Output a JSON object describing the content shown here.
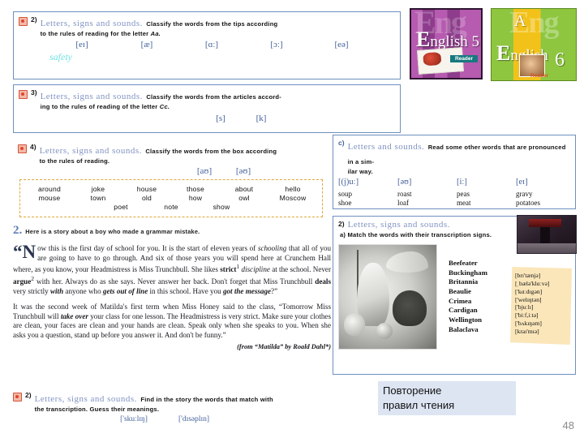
{
  "slide": {
    "page_number": "48",
    "caption": "Повторение\nправил чтения",
    "caption_line1": "Повторение",
    "caption_line2": "правил чтения",
    "caption_bg": "#dde5f3",
    "accent_title_color": "#8193c2",
    "transcription_color": "#44619b",
    "answer_color": "#6fe3e0"
  },
  "ex2": {
    "number": "2)",
    "title": "Letters, signs and sounds.",
    "instruction_line1": "Classify the words from the tips according",
    "instruction_line2": "to the rules of reading for the letter ",
    "instruction_letter": "Aa.",
    "transcriptions": [
      "[eɪ]",
      "[æ]",
      "[ɑː]",
      "[ɔː]",
      "[eə]"
    ],
    "answer": "safety"
  },
  "ex3": {
    "number": "3)",
    "title": "Letters, signs and sounds.",
    "instruction_line1": "Classify the words from the articles accord-",
    "instruction_line2": "ing to the rules of reading of the letter ",
    "instruction_letter": "Cc.",
    "transcriptions": [
      "[s]",
      "[k]"
    ]
  },
  "ex4": {
    "number": "4)",
    "title": "Letters, signs and sounds.",
    "instruction_line1": "Classify the words from the box according",
    "instruction_line2": "to the rules of reading.",
    "transcriptions": [
      "[aʊ]",
      "[əʊ]"
    ],
    "wordbox": {
      "row1": [
        "around",
        "joke",
        "house",
        "those",
        "about",
        "hello"
      ],
      "row2": [
        "mouse",
        "town",
        "old",
        "how",
        "owl",
        "Moscow"
      ],
      "row3": [
        "poet",
        "note",
        "show"
      ]
    }
  },
  "story": {
    "number": "2.",
    "subtitle": "Here is a story about a boy who made a grammar mistake.",
    "dropcap": "N",
    "opening_quote": "“",
    "paragraph1": "ow this is the first day of school for you. It is the start of eleven years of <i>schooling</i> that all of you are going to have to go through. And six of those years you will spend here at Crunchem Hall where, as you know, your Headmistress is Miss Trunchbull. She likes <b>strict</b><sup>1</sup> <i>discipline</i> at the school. Never <b>argue</b><sup>2</sup> with her. Always do as she says. Never answer her back. Don't forget that Miss Trunchbull <b>deals</b> very strictly <b><i>with</i></b> anyone who <b><i>gets out of line</i></b> in this school. Have you <b><i>got the message</i></b>?”",
    "paragraph2": "It was the second week of Matilda's first term when Miss Honey said to the class, “Tomorrow Miss Trunchbull will <b><i>take over</i></b> your class for one lesson. The Headmistress is very strict. Make sure your clothes are clean, your faces are clean and your hands are clean. Speak only when she speaks to you. When she asks you a question, stand up before you answer it. And don't be funny.”",
    "source": "(from “Matilda” by Roald Dahl*)"
  },
  "ex2b": {
    "number": "2)",
    "title": "Letters, signs and sounds.",
    "instruction_line1": "Find in the story the words that match with",
    "instruction_line2": "the transcription. Guess their meanings.",
    "transcriptions": [
      "['skuːlɪŋ]",
      "['dɪsəplɪn]"
    ]
  },
  "exC": {
    "number": "c)",
    "title": "Letters and sounds.",
    "instruction_line1": "Read some other words that are pronounced in a sim-",
    "instruction_line2": "ilar way.",
    "columns": [
      {
        "symbol": "[(j)uː]",
        "words": [
          "soup",
          "shoe"
        ]
      },
      {
        "symbol": "[əʊ]",
        "words": [
          "roast",
          "loaf"
        ]
      },
      {
        "symbol": "[iː]",
        "words": [
          "peas",
          "meat"
        ]
      },
      {
        "symbol": "[eɪ]",
        "words": [
          "gravy",
          "potatoes"
        ]
      }
    ]
  },
  "exR": {
    "number": "2)",
    "title": "Letters, signs and sounds.",
    "instruction": "a) Match the words with their transcription signs.",
    "words": [
      "Beefeater",
      "Buckingham",
      "Britannia",
      "Beaulie",
      "Crimea",
      "Cardigan",
      "Wellington",
      "Balaclava"
    ],
    "transcriptions": [
      "[brɪ'tænjə]",
      "[ˌbælə'klɑːvə]",
      "['kɑːdɪgən]",
      "['welɪŋtən]",
      "['bjuːlɪ]",
      "['biːf,iːtə]",
      "['bʌkɪŋəm]",
      "[kraɪ'mɪə]"
    ],
    "engraving_alt": "britannia-engraving",
    "photo_alt": "dark-interior-photo"
  },
  "books": {
    "book5": {
      "ghost": "Eng",
      "title_first": "E",
      "title_rest": "nglish 5",
      "badge": "Reader"
    },
    "book6": {
      "letter_a": "A",
      "ghost": "Eng",
      "title_first": "E",
      "title_rest": "nglish",
      "number": "6",
      "badge": "Reader"
    }
  }
}
